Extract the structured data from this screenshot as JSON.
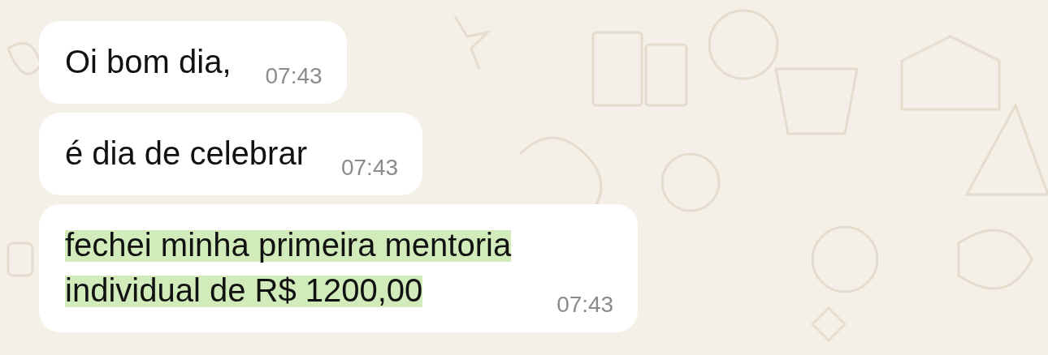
{
  "messages": [
    {
      "lines": [
        "Oi bom dia,"
      ],
      "time": "07:43",
      "highlighted": false
    },
    {
      "lines": [
        "é dia de celebrar"
      ],
      "time": "07:43",
      "highlighted": false
    },
    {
      "lines": [
        "fechei minha primeira mentoria",
        "individual de R$ 1200,00"
      ],
      "time": "07:43",
      "highlighted": true
    }
  ]
}
